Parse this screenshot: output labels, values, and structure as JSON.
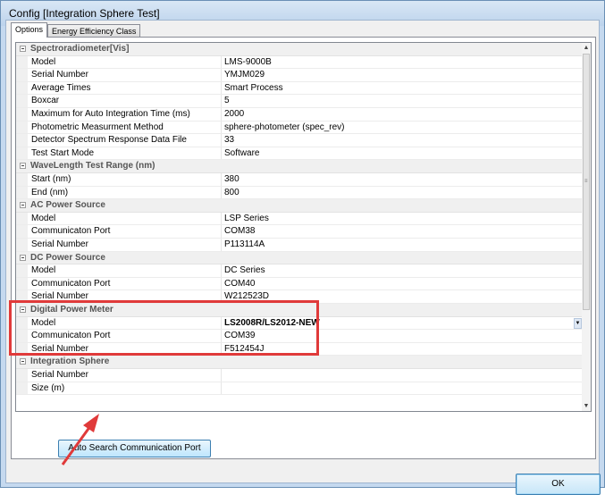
{
  "window": {
    "title": "Config [Integration Sphere Test]"
  },
  "tabs": [
    {
      "label": "Options",
      "active": true
    },
    {
      "label": "Energy Efficiency Class",
      "active": false
    }
  ],
  "grid": {
    "categories": [
      {
        "label": "Spectroradiometer[Vis]",
        "props": [
          {
            "name": "Model",
            "value": "LMS-9000B"
          },
          {
            "name": "Serial Number",
            "value": "YMJM029"
          },
          {
            "name": "Average Times",
            "value": "Smart Process"
          },
          {
            "name": "Boxcar",
            "value": "5"
          },
          {
            "name": "Maximum for Auto Integration Time (ms)",
            "value": "2000"
          },
          {
            "name": "Photometric Measurment Method",
            "value": "sphere-photometer (spec_rev)"
          },
          {
            "name": "Detector Spectrum Response Data File",
            "value": "33"
          },
          {
            "name": "Test Start Mode",
            "value": "Software"
          }
        ]
      },
      {
        "label": "WaveLength Test Range (nm)",
        "props": [
          {
            "name": "Start (nm)",
            "value": "380"
          },
          {
            "name": "End (nm)",
            "value": "800"
          }
        ]
      },
      {
        "label": "AC Power Source",
        "props": [
          {
            "name": "Model",
            "value": "LSP Series"
          },
          {
            "name": "Communicaton Port",
            "value": "COM38"
          },
          {
            "name": "Serial Number",
            "value": "P113114A"
          }
        ]
      },
      {
        "label": "DC Power Source",
        "props": [
          {
            "name": "Model",
            "value": "DC Series"
          },
          {
            "name": "Communicaton Port",
            "value": "COM40"
          },
          {
            "name": "Serial Number",
            "value": "W212523D"
          }
        ]
      },
      {
        "label": "Digital Power Meter",
        "props": [
          {
            "name": "Model",
            "value": "LS2008R/LS2012-NEW",
            "bold": true,
            "dropdown": true
          },
          {
            "name": "Communicaton Port",
            "value": "COM39"
          },
          {
            "name": "Serial Number",
            "value": "F512454J"
          }
        ]
      },
      {
        "label": "Integration Sphere",
        "props": [
          {
            "name": "Serial Number",
            "value": ""
          },
          {
            "name": "Size (m)",
            "value": ""
          }
        ]
      }
    ]
  },
  "buttons": {
    "auto_search": "Auto Search Communication Port",
    "ok": "OK"
  },
  "colors": {
    "highlight": "#e03a3a",
    "accent_button": "#3c7fb1"
  }
}
